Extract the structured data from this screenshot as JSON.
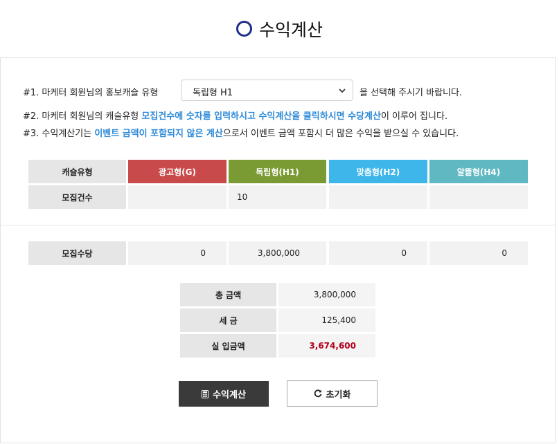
{
  "page_title": "수익계산",
  "intro": {
    "line1_prefix": "#1. 마케터 회원님의 홍보캐슬 유형",
    "line1_suffix": "을 선택해 주시기 바랍니다.",
    "select_value": "독립형 H1",
    "line2_prefix": "#2. 마케터 회원님의 캐슬유형 ",
    "line2_highlight": "모집건수에 숫자를 입력하시고 수익계산을 클릭하시면 수당계산",
    "line2_suffix": "이 이루어 집니다.",
    "line3_prefix": "#3. 수익계산기는 ",
    "line3_highlight": "이벤트 금액이 포함되지 않은 계산",
    "line3_suffix": "으로서 이벤트 금액 포함시 더 많은 수익을 받으실 수 있습니다."
  },
  "type_table": {
    "row_header_type": "캐슬유형",
    "row_header_count": "모집건수",
    "types": [
      {
        "label": "광고형(G)",
        "color": "#c94a4a",
        "count": ""
      },
      {
        "label": "독립형(H1)",
        "color": "#7a9a33",
        "count": "10"
      },
      {
        "label": "맞춤형(H2)",
        "color": "#3fb6ea",
        "count": ""
      },
      {
        "label": "알뜰형(H4)",
        "color": "#5fb8c2",
        "count": ""
      }
    ]
  },
  "allowance": {
    "label": "모집수당",
    "values": [
      "0",
      "3,800,000",
      "0",
      "0"
    ]
  },
  "summary": {
    "total_label": "총 금액",
    "total_value": "3,800,000",
    "tax_label": "세 금",
    "tax_value": "125,400",
    "net_label": "실 입금액",
    "net_value": "3,674,600",
    "net_color": "#b3001b"
  },
  "buttons": {
    "calc_label": "수익계산",
    "reset_label": "초기화"
  },
  "icons": {
    "title": "circle-outline-icon",
    "calc": "calculator-icon",
    "reset": "refresh-icon",
    "select": "chevron-down-icon"
  }
}
